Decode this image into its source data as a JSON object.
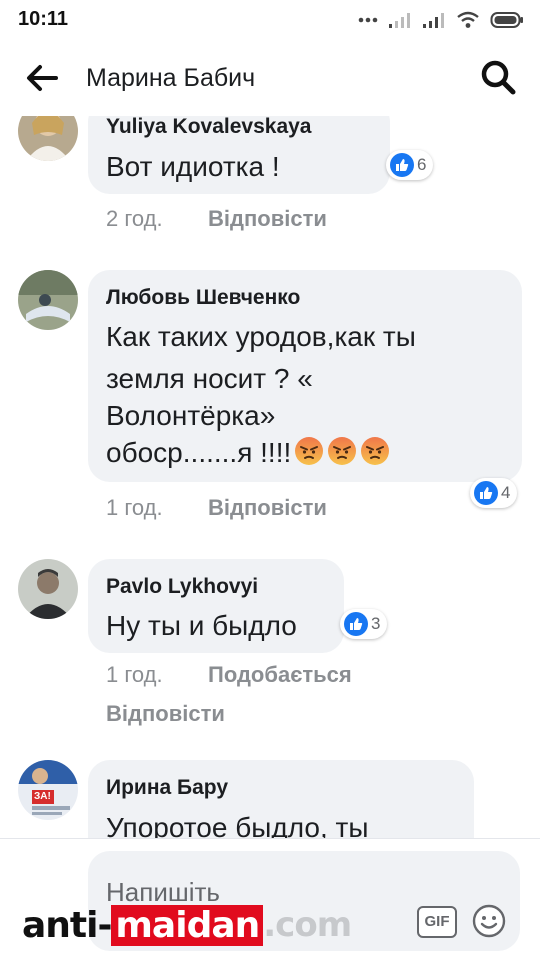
{
  "status_bar": {
    "time": "10:11"
  },
  "header": {
    "title": "Марина Бабич"
  },
  "comments": [
    {
      "author": "Yuliya Kovalevskaya",
      "lines": [
        "Вот идиотка !"
      ],
      "reactions": {
        "icon": "like-icon",
        "count": "6"
      },
      "time": "2 год.",
      "actions": [
        "Відповісти"
      ]
    },
    {
      "author": "Любовь Шевченко",
      "lines": [
        "Как таких уродов,как ты",
        "земля носит ? «",
        "Волонтёрка»",
        "обоср.......я !!!!"
      ],
      "trailing_emoji": [
        "angry-face-emoji",
        "angry-face-emoji",
        "angry-face-emoji"
      ],
      "reactions": {
        "icon": "like-icon",
        "count": "4"
      },
      "time": "1 год.",
      "actions": [
        "Відповісти"
      ]
    },
    {
      "author": "Pavlo Lykhovyi",
      "lines": [
        "Ну ты и быдло"
      ],
      "reactions": {
        "icon": "like-icon",
        "count": "3"
      },
      "time": "1 год.",
      "actions": [
        "Подобається",
        "Відповісти"
      ]
    },
    {
      "author": "Ирина Бару",
      "lines": [
        "Упоротое быдло, ты"
      ],
      "avatar_text": "ЗА!"
    }
  ],
  "composer": {
    "placeholder": "Напишіть",
    "gif_label": "GIF"
  },
  "watermark": {
    "part1": "anti-",
    "part2": "maidan",
    "part3": ".com"
  },
  "colors": {
    "like_blue": "#1877f2",
    "bubble": "#f0f2f5",
    "meta_gray": "#8a8d91",
    "watermark_red": "#e10b1e"
  }
}
